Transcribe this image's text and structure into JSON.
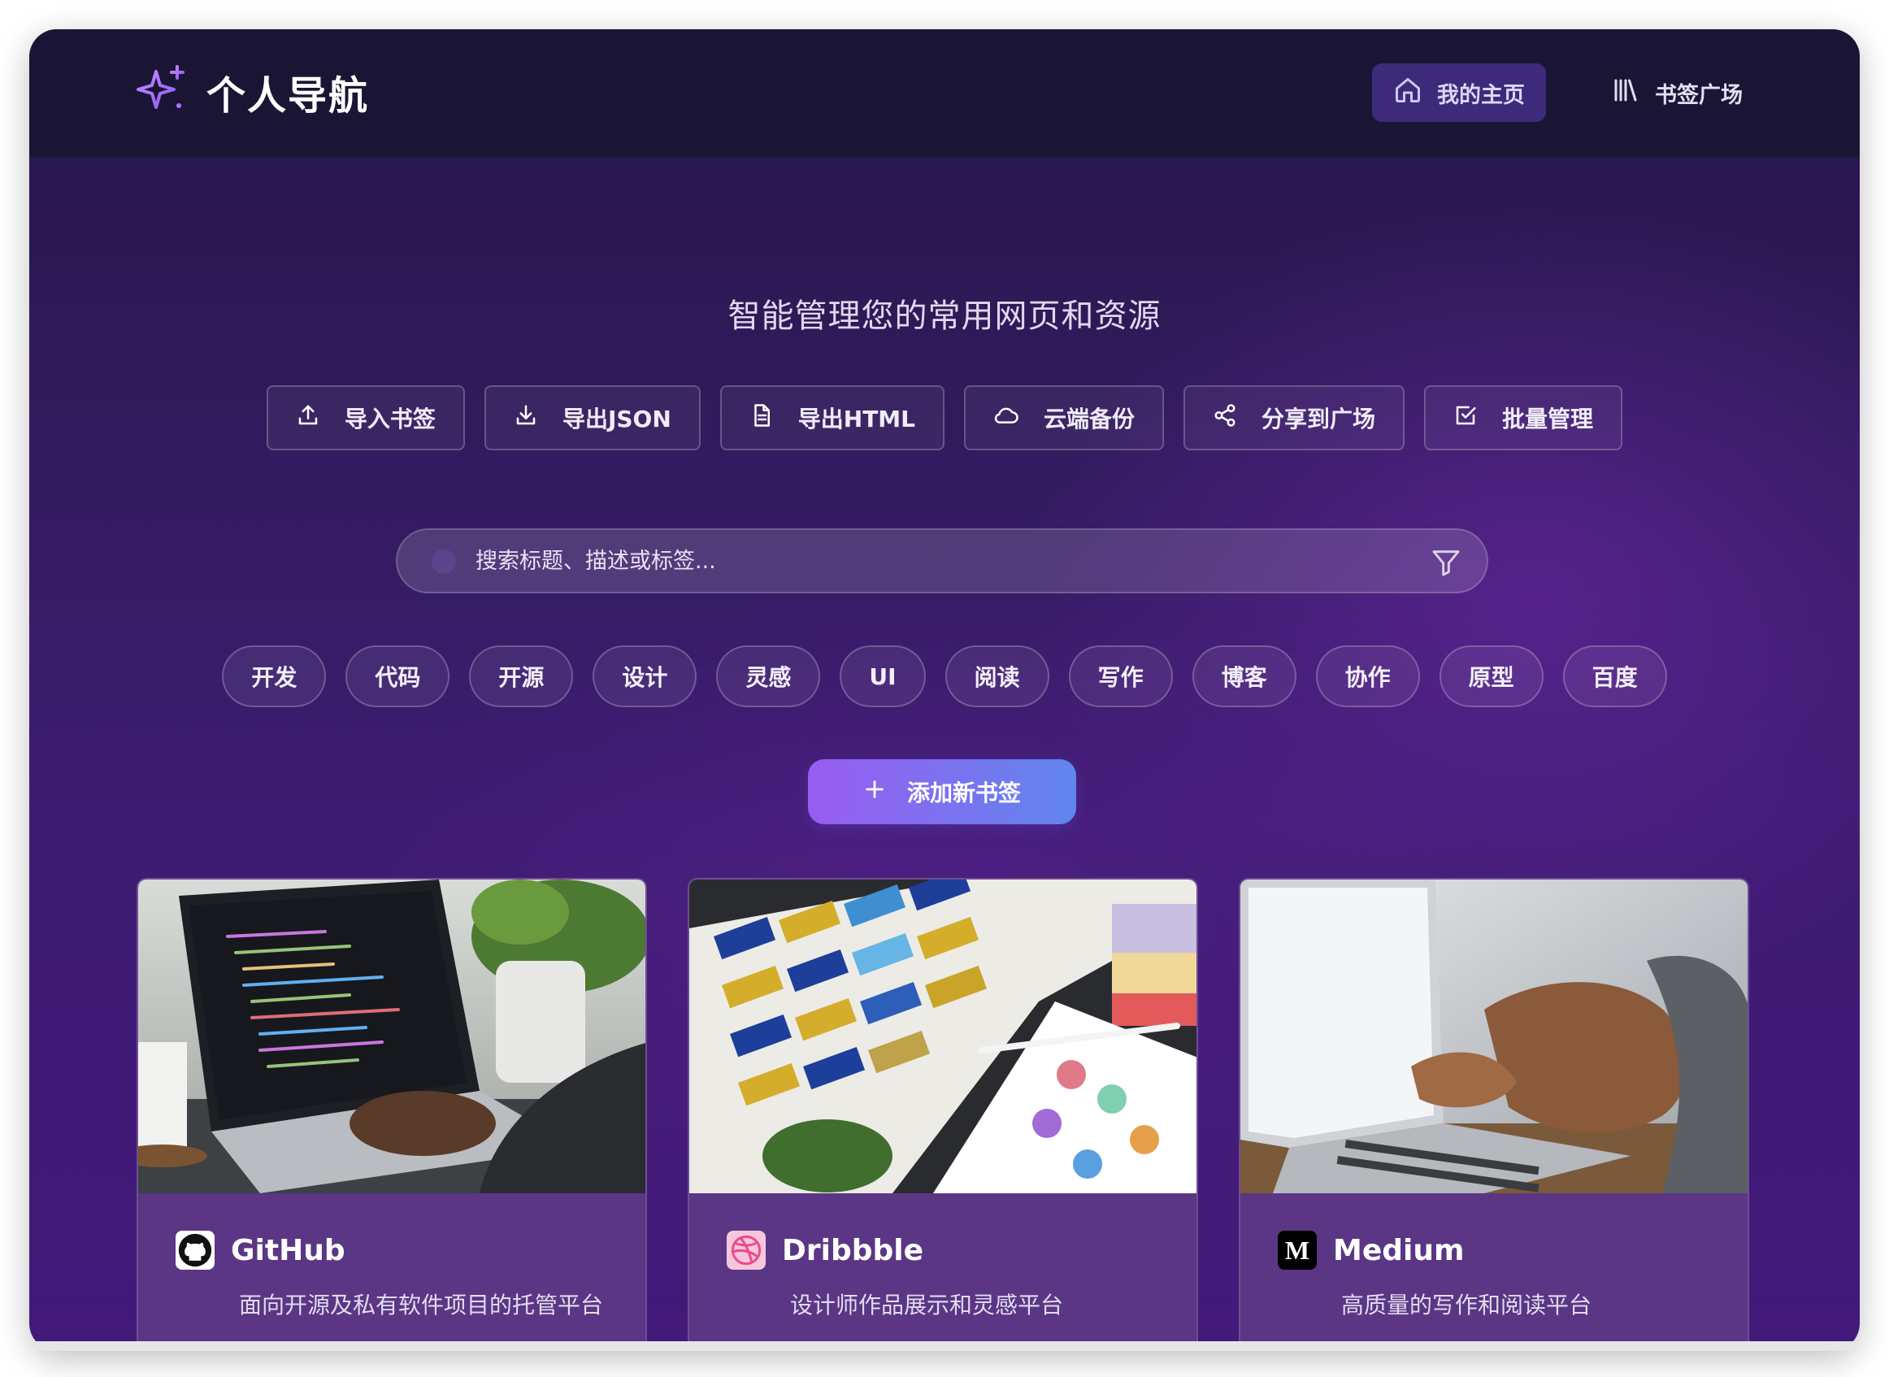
{
  "header": {
    "title": "个人导航",
    "nav": {
      "home_label": "我的主页",
      "square_label": "书签广场"
    }
  },
  "hero": {
    "subtitle": "智能管理您的常用网页和资源"
  },
  "toolbar": {
    "import_label": "导入书签",
    "export_json_label": "导出JSON",
    "export_html_label": "导出HTML",
    "cloud_backup_label": "云端备份",
    "share_label": "分享到广场",
    "batch_label": "批量管理"
  },
  "search": {
    "placeholder": "搜索标题、描述或标签..."
  },
  "tags": [
    "开发",
    "代码",
    "开源",
    "设计",
    "灵感",
    "UI",
    "阅读",
    "写作",
    "博客",
    "协作",
    "原型",
    "百度"
  ],
  "add_button": {
    "label": "添加新书签"
  },
  "bookmarks": [
    {
      "title": "GitHub",
      "description": "面向开源及私有软件项目的托管平台",
      "icon": "github-icon"
    },
    {
      "title": "Dribbble",
      "description": "设计师作品展示和灵感平台",
      "icon": "dribbble-icon"
    },
    {
      "title": "Medium",
      "description": "高质量的写作和阅读平台",
      "icon": "medium-icon",
      "icon_text": "M"
    }
  ],
  "colors": {
    "topbar": "#1b1535",
    "accent": "#9a5cf0",
    "accent_end": "#5f86ee",
    "home_active": "#3d2a7a",
    "card": "#5b3685"
  }
}
